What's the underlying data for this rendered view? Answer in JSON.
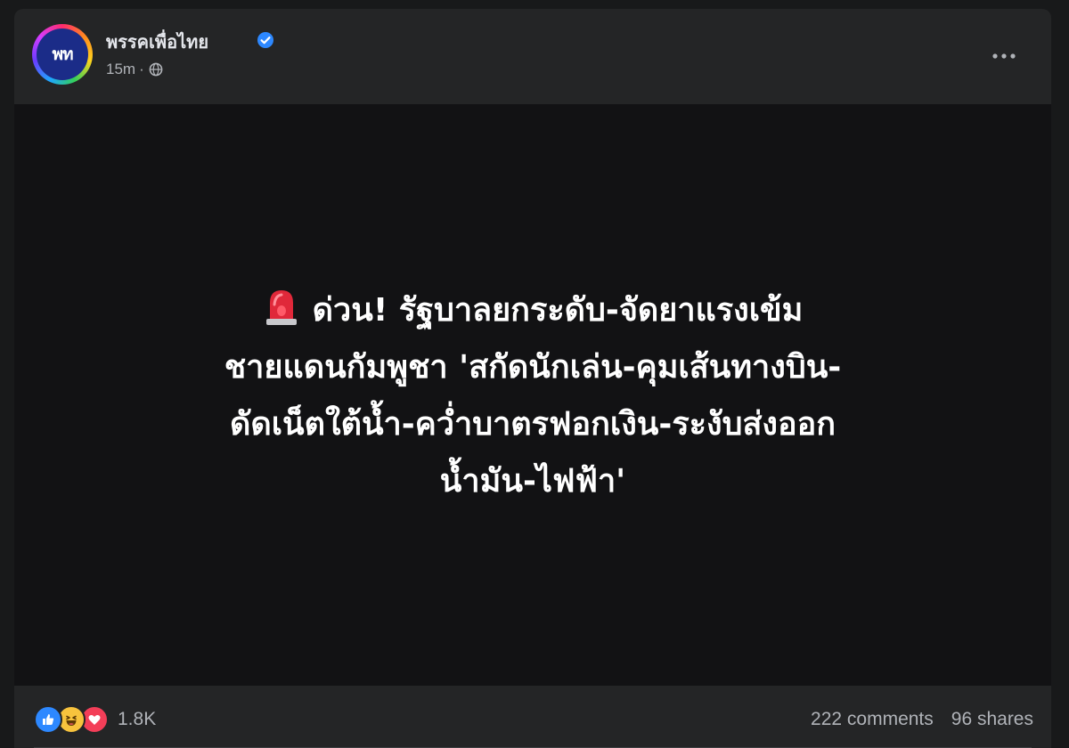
{
  "post": {
    "page_name": "พรรคเพื่อไทย",
    "avatar_text": "พท",
    "time": "15m",
    "separator": "·",
    "privacy_icon": "globe-icon",
    "verified_icon": "verified-badge-icon",
    "more_icon": "more-options-icon"
  },
  "media": {
    "background_color": "#121214",
    "headline_icon": "siren-icon",
    "headline_lines": [
      "ด่วน! รัฐบาลยกระดับ-จัดยาแรงเข้ม",
      "ชายแดนกัมพูชา 'สกัดนักเล่น-คุมเส้นทางบิน-",
      "ดัดเน็ตใต้น้ำ-คว่ำบาตรฟอกเงิน-ระงับส่งออก",
      "น้ำมัน-ไฟฟ้า'"
    ]
  },
  "footer": {
    "reaction_icons": [
      "like-icon",
      "haha-icon",
      "love-icon"
    ],
    "reaction_count": "1.8K",
    "comments": "222 comments",
    "shares": "96 shares"
  },
  "colors": {
    "page_bg": "#18191a",
    "card_bg": "#242526",
    "text_primary": "#e4e6eb",
    "text_secondary": "#b0b3b8",
    "verified_blue": "#2d88ff"
  }
}
